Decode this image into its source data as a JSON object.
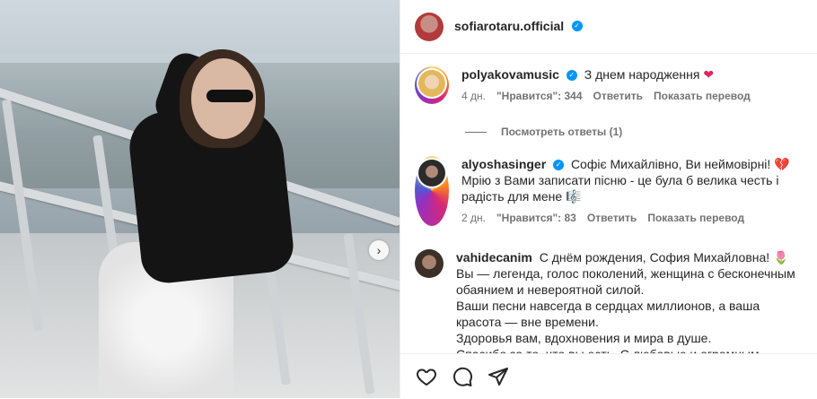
{
  "post": {
    "author": {
      "username": "sofiarotaru.official",
      "verified": true
    }
  },
  "comments": [
    {
      "username": "polyakovamusic",
      "verified": true,
      "text": "З днем народження",
      "emoji": "❤",
      "time": "4 дн.",
      "likes": "\"Нравится\": 344",
      "reply_label": "Ответить",
      "translate_label": "Показать перевод"
    },
    {
      "username": "alyoshasinger",
      "verified": true,
      "text": "Софіє Михайлівно, Ви неймовірні! 💔 Мрію з Вами записати пісню - це була б велика честь і радість для мене 🎼",
      "time": "2 дн.",
      "likes": "\"Нравится\": 83",
      "reply_label": "Ответить",
      "translate_label": "Показать перевод"
    },
    {
      "username": "vahidecanim",
      "verified": false,
      "text_lines": [
        "С днём рождения, София Михайловна! 🌷",
        "Вы — легенда, голос поколений, женщина с бесконечным обаянием и невероятной силой.",
        "Ваши песни навсегда в сердцах миллионов, а ваша красота — вне времени.",
        "Здоровья вам, вдохновения и мира в душе.",
        "Спасибо за то, что вы есть. С любовью и огромным"
      ]
    }
  ],
  "view_replies_label": "Посмотреть ответы (1)",
  "icons": {
    "like": "heart-icon",
    "comment": "comment-icon",
    "share": "send-icon",
    "next": "chevron-right-icon"
  },
  "colors": {
    "verified": "#0095f6",
    "muted": "#737373",
    "text": "#262626"
  }
}
